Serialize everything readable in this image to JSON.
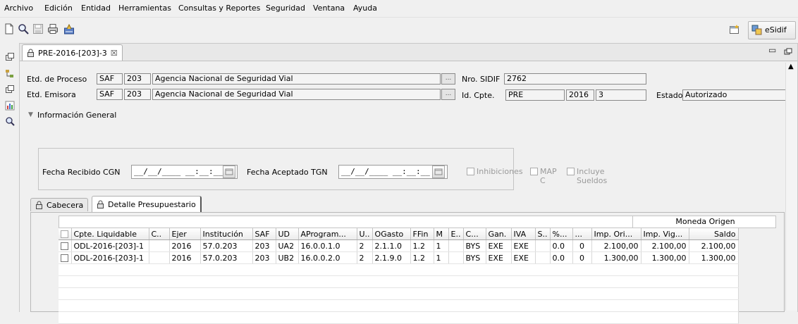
{
  "menu": [
    "Archivo",
    "Edición",
    "Entidad",
    "Herramientas",
    "Consultas y Reportes",
    "Seguridad",
    "Ventana",
    "Ayuda"
  ],
  "perspective_label": "eSidif",
  "editor_tab": {
    "title": "PRE-2016-[203]-3",
    "close": "☒"
  },
  "header": {
    "etd_proceso_label": "Etd. de Proceso",
    "etd_proceso": {
      "saf": "SAF",
      "code": "203",
      "name": "Agencia Nacional de Seguridad Vial"
    },
    "etd_emisora_label": "Etd. Emisora",
    "etd_emisora": {
      "saf": "SAF",
      "code": "203",
      "name": "Agencia Nacional de Seguridad Vial"
    },
    "dots": "...",
    "nro_sidif_label": "Nro. SIDIF",
    "nro_sidif": "2762",
    "id_cpte_label": "Id. Cpte.",
    "id_cpte": {
      "type": "PRE",
      "year": "2016",
      "num": "3"
    },
    "estado_label": "Estado",
    "estado": "Autorizado"
  },
  "info_general": {
    "toggle_label": "Información General",
    "fecha_recibido_label": "Fecha Recibido CGN",
    "fecha_recibido": "__/__/____ __:__:__",
    "fecha_aceptado_label": "Fecha Aceptado TGN",
    "fecha_aceptado": "__/__/____ __:__:__",
    "inhibiciones": "Inhibiciones",
    "map_c": "MAP C",
    "incluye_sueldos": "Incluye Sueldos"
  },
  "subtabs": [
    "Cabecera",
    "Detalle Presupuestario"
  ],
  "table": {
    "group_header": "Moneda Origen",
    "columns": [
      "Cpte. Liquidable",
      "C..",
      "Ejer",
      "Institución",
      "SAF",
      "UD",
      "AProgram...",
      "U..",
      "OGasto",
      "FFin",
      "M",
      "E..",
      "C...",
      "Gan.",
      "IVA",
      "S..",
      "%...",
      "...",
      "Imp. Ori...",
      "Imp. Vig...",
      "Saldo"
    ],
    "rows": [
      [
        "ODL-2016-[203]-1",
        "",
        "2016",
        "57.0.203",
        "203",
        "UA2",
        "16.0.0.1.0",
        "2",
        "2.1.1.0",
        "1.2",
        "1",
        "",
        "BYS",
        "EXE",
        "EXE",
        "",
        "0.0",
        "0",
        "2.100,00",
        "2.100,00",
        "2.100,00"
      ],
      [
        "ODL-2016-[203]-1",
        "",
        "2016",
        "57.0.203",
        "203",
        "UB2",
        "16.0.0.2.0",
        "2",
        "2.1.9.0",
        "1.2",
        "1",
        "",
        "BYS",
        "EXE",
        "EXE",
        "",
        "0.0",
        "0",
        "1.300,00",
        "1.300,00",
        "1.300,00"
      ]
    ]
  }
}
